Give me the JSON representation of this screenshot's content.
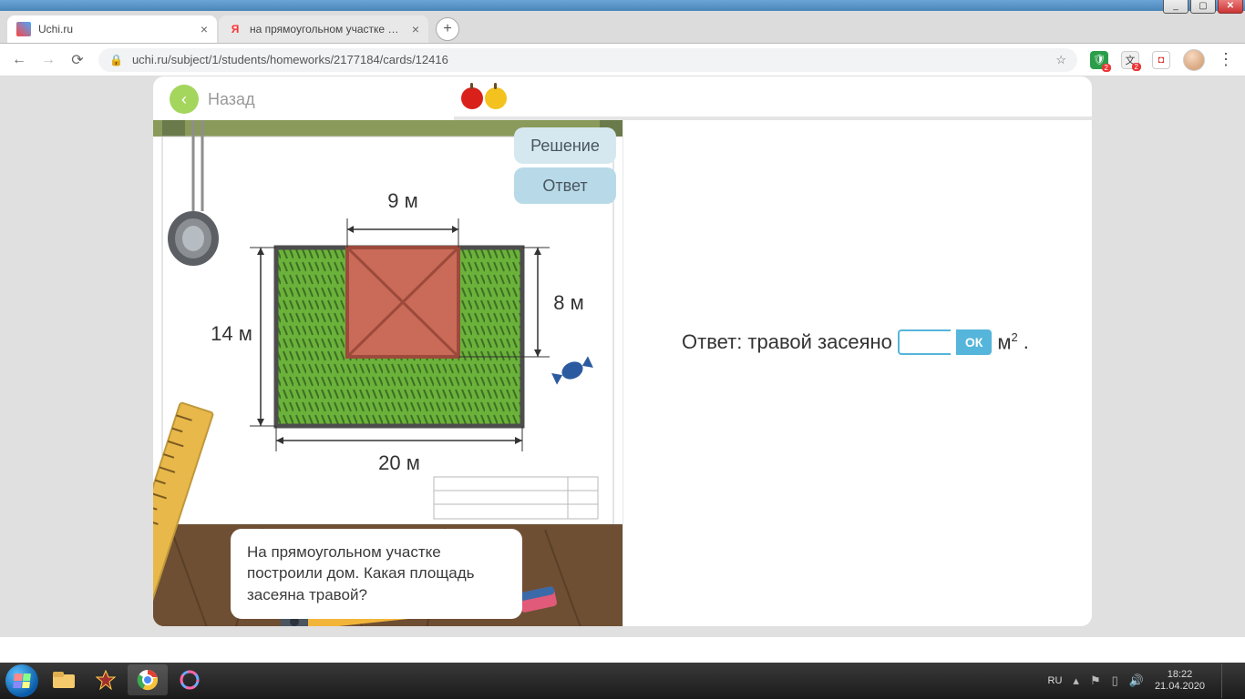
{
  "window": {
    "controls": {
      "min": "_",
      "max": "▢",
      "close": "✕"
    }
  },
  "tabs": [
    {
      "title": "Uchi.ru",
      "favicon": "uchi"
    },
    {
      "title": "на прямоугольном участке постро",
      "favicon": "yandex",
      "favicon_char": "Я"
    }
  ],
  "new_tab_symbol": "+",
  "nav": {
    "back": "←",
    "forward": "→",
    "reload": "⟳"
  },
  "address": {
    "lock": "🔒",
    "url": "uchi.ru/subject/1/students/homeworks/2177184/cards/12416",
    "star": "☆"
  },
  "extensions": {
    "shield_badge": "2",
    "translate_badge": "2"
  },
  "app": {
    "back_arrow": "‹",
    "back_label": "Назад",
    "tab_solution": "Решение",
    "tab_answer": "Ответ"
  },
  "diagram": {
    "top_dim": "9 м",
    "left_dim": "14 м",
    "right_dim": "8 м",
    "bottom_dim": "20 м"
  },
  "problem_text": "На прямоугольном участке построили дом. Какая площадь засеяна травой?",
  "answer": {
    "prefix": "Ответ: травой засеяно",
    "input_value": "",
    "ok": "ОК",
    "unit": "м",
    "unit_sup": "2",
    "suffix": "."
  },
  "taskbar": {
    "lang": "RU",
    "time": "18:22",
    "date": "21.04.2020"
  }
}
